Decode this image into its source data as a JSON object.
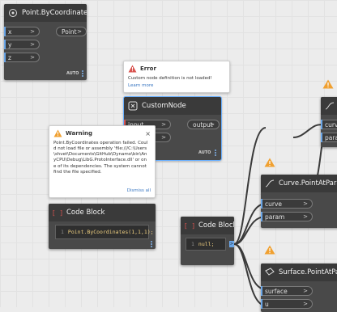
{
  "nodes": {
    "point": {
      "title": "Point.ByCoordinates",
      "inputs": [
        "x",
        "y",
        "z"
      ],
      "output": "Point",
      "auto": "AUTO"
    },
    "custom": {
      "title": "CustomNode",
      "inputs": [
        "input",
        ""
      ],
      "output": "output",
      "auto": "AUTO"
    },
    "code1": {
      "title": "Code Block",
      "line_number": "1",
      "code": "Point.ByCoordinates(1,1,1);"
    },
    "code2": {
      "title": "Code Block",
      "line_number": "1",
      "code": "null;"
    },
    "curve": {
      "title": "Curve.PointAtParameter",
      "inputs": [
        "curve",
        "param"
      ]
    },
    "surface": {
      "title": "Surface.PointAtParameter",
      "inputs": [
        "surface",
        "u"
      ]
    },
    "partial": {
      "inputs": [
        "curv",
        "para"
      ]
    }
  },
  "popups": {
    "error": {
      "title": "Error",
      "message": "Custom node definition is not loaded!",
      "link": "Learn more"
    },
    "warning": {
      "title": "Warning",
      "message": "Point.ByCoordinates operation failed. Could not load file or assembly 'file:///C:\\Users\\shvet\\Documents\\GitHub\\Dynamo\\bin\\AnyCPU\\Debug\\LibG.ProtoInterface.dll' or one of its dependencies. The system cannot find the file specified.",
      "link": "Dismiss all"
    }
  },
  "colors": {
    "node_body": "#494949",
    "node_header": "#3a3a3a",
    "wire": "#3a3a3a",
    "port_marker": "#6aa6e8",
    "error_red": "#d9534f",
    "warning_orange": "#f0a030",
    "link_blue": "#3b78c2"
  }
}
